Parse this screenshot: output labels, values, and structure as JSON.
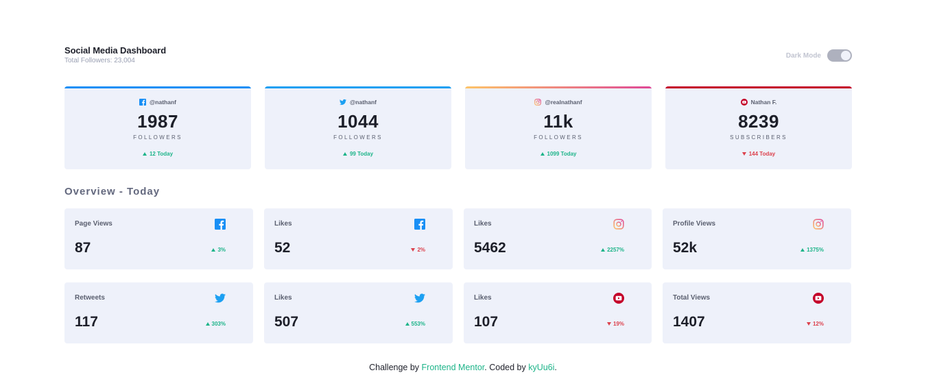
{
  "header": {
    "title": "Social Media Dashboard",
    "total": "Total Followers: 23,004"
  },
  "toggle": {
    "label": "Dark Mode",
    "on": false
  },
  "colors": {
    "facebook": "#198ff5",
    "twitter": "#1ca0f2",
    "instagram_start": "#fdc468",
    "instagram_end": "#df4996",
    "youtube": "#c4032a",
    "up": "#1db489",
    "down": "#dc414c"
  },
  "cards": [
    {
      "platform": "facebook",
      "icon": "facebook-icon",
      "handle": "@nathanf",
      "count": "1987",
      "metric": "FOLLOWERS",
      "delta": "12 Today",
      "trend": "up"
    },
    {
      "platform": "twitter",
      "icon": "twitter-icon",
      "handle": "@nathanf",
      "count": "1044",
      "metric": "FOLLOWERS",
      "delta": "99 Today",
      "trend": "up"
    },
    {
      "platform": "instagram",
      "icon": "instagram-icon",
      "handle": "@realnathanf",
      "count": "11k",
      "metric": "FOLLOWERS",
      "delta": "1099 Today",
      "trend": "up"
    },
    {
      "platform": "youtube",
      "icon": "youtube-icon",
      "handle": "Nathan F.",
      "count": "8239",
      "metric": "SUBSCRIBERS",
      "delta": "144 Today",
      "trend": "down"
    }
  ],
  "overview": {
    "title": "Overview - Today",
    "tiles": [
      {
        "label": "Page Views",
        "value": "87",
        "delta": "3%",
        "trend": "up",
        "icon": "facebook-icon"
      },
      {
        "label": "Likes",
        "value": "52",
        "delta": "2%",
        "trend": "down",
        "icon": "facebook-icon"
      },
      {
        "label": "Likes",
        "value": "5462",
        "delta": "2257%",
        "trend": "up",
        "icon": "instagram-icon"
      },
      {
        "label": "Profile Views",
        "value": "52k",
        "delta": "1375%",
        "trend": "up",
        "icon": "instagram-icon"
      },
      {
        "label": "Retweets",
        "value": "117",
        "delta": "303%",
        "trend": "up",
        "icon": "twitter-icon"
      },
      {
        "label": "Likes",
        "value": "507",
        "delta": "553%",
        "trend": "up",
        "icon": "twitter-icon"
      },
      {
        "label": "Likes",
        "value": "107",
        "delta": "19%",
        "trend": "down",
        "icon": "youtube-icon"
      },
      {
        "label": "Total Views",
        "value": "1407",
        "delta": "12%",
        "trend": "down",
        "icon": "youtube-icon"
      }
    ]
  },
  "footer": {
    "prefix": "Challenge by ",
    "link1": "Frontend Mentor",
    "middle": ". Coded by ",
    "link2": "kyUu6i",
    "suffix": "."
  }
}
